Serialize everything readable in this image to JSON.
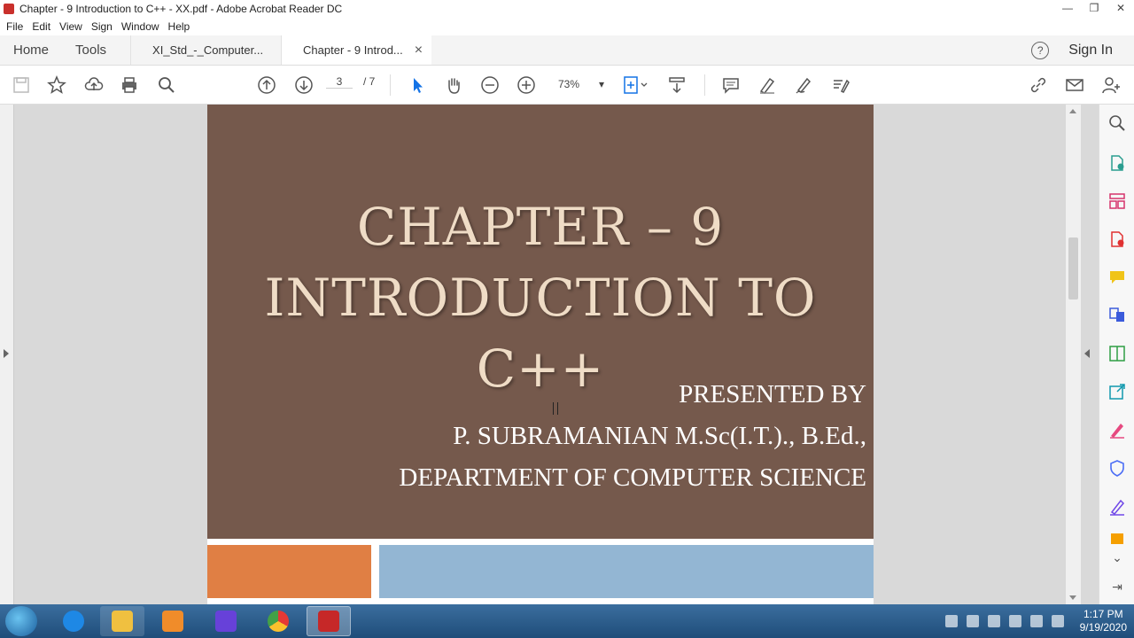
{
  "window": {
    "title": "Chapter - 9 Introduction to C++ - XX.pdf - Adobe Acrobat Reader DC",
    "minimize": "—",
    "maximize": "❐",
    "close": "✕"
  },
  "menu": [
    "File",
    "Edit",
    "View",
    "Sign",
    "Window",
    "Help"
  ],
  "tabs": {
    "home": "Home",
    "tools": "Tools",
    "doc1": "XI_Std_-_Computer...",
    "doc2": "Chapter - 9 Introd...",
    "doc2_close": "×",
    "help": "?",
    "sign_in": "Sign In"
  },
  "toolbar": {
    "current_page": "3",
    "page_total": "/ 7",
    "zoom": "73%"
  },
  "slide": {
    "title_line1": "CHAPTER – 9",
    "title_line2": "INTRODUCTION TO C++",
    "presented_by": "PRESENTED BY",
    "presenter_name": "P. SUBRAMANIAN M.Sc(I.T.)., B.Ed.,",
    "department": "DEPARTMENT OF COMPUTER SCIENCE",
    "background_color": "#75594c",
    "title_color": "#efdcc6",
    "orange_accent": "#e07f44",
    "blue_accent": "#93b6d3"
  },
  "taskbar": {
    "time": "1:17 PM",
    "date": "9/19/2020",
    "apps": [
      "windows-explorer-icon",
      "internet-explorer-icon",
      "file-explorer-icon",
      "media-player-icon",
      "visual-studio-icon",
      "chrome-icon",
      "acrobat-icon"
    ]
  }
}
